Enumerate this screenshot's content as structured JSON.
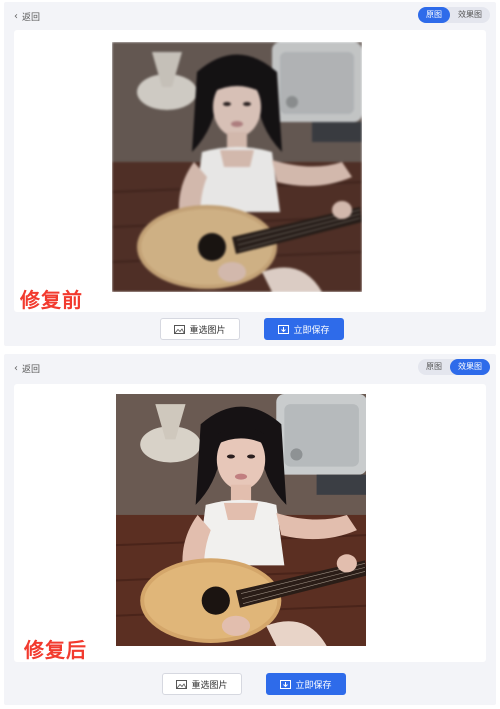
{
  "top": {
    "back_label": "返回",
    "toggle": {
      "original": "原图",
      "effect": "效果图",
      "active": "original"
    },
    "stamp": "修复前",
    "reselect_label": "重选图片",
    "save_label": "立即保存"
  },
  "bottom": {
    "back_label": "返回",
    "toggle": {
      "original": "原图",
      "effect": "效果图",
      "active": "effect"
    },
    "stamp": "修复后",
    "reselect_label": "重选图片",
    "save_label": "立即保存"
  },
  "colors": {
    "accent": "#2e6bea",
    "stamp": "#f23a2e",
    "panel_bg": "#f3f4f8"
  },
  "icons": {
    "back": "chevron-left-icon",
    "reselect": "image-icon",
    "save": "download-icon"
  }
}
